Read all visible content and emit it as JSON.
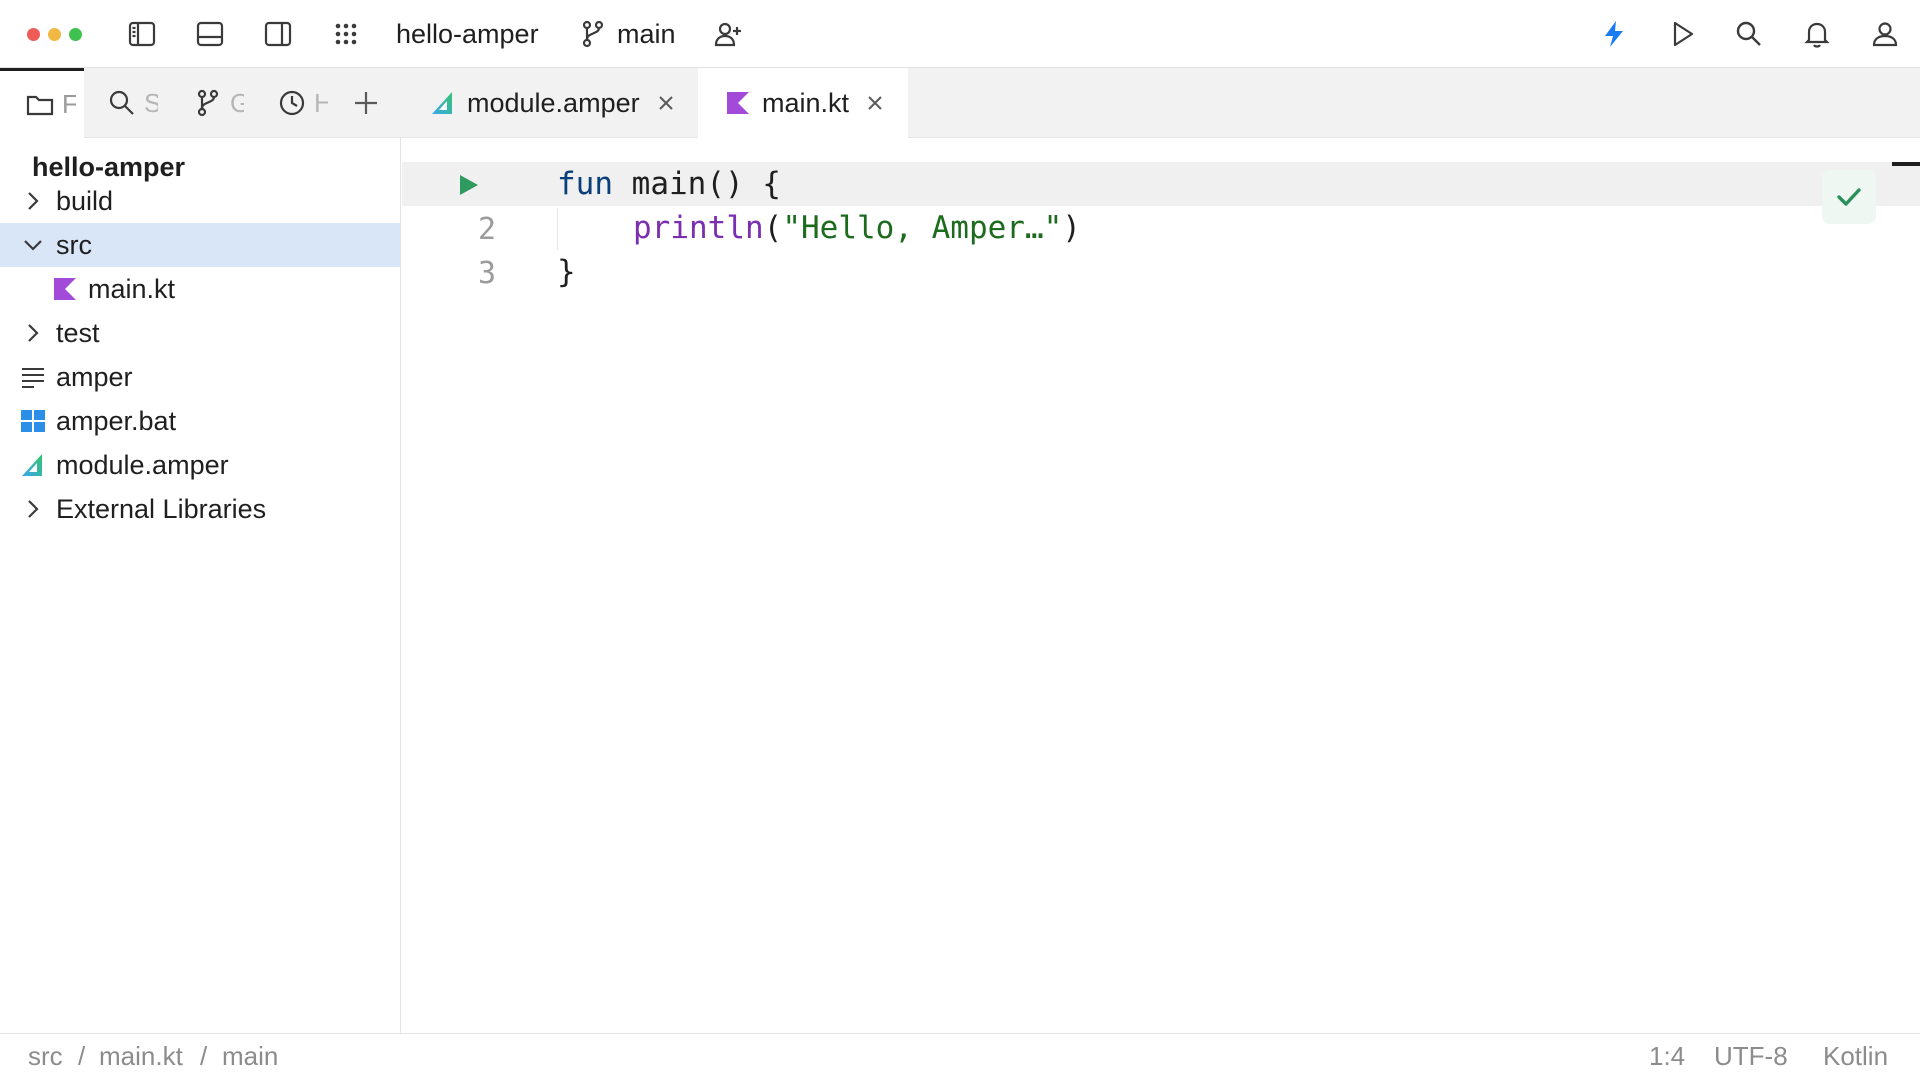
{
  "window": {
    "traffic_lights": {
      "close_color": "#ee5c56",
      "minimize_color": "#f1b844",
      "zoom_color": "#3fc24f"
    }
  },
  "titlebar": {
    "project_name": "hello-amper",
    "branch": "main",
    "icons": [
      "left-panel-icon",
      "bottom-panel-icon",
      "right-panel-icon",
      "apps-grid-icon",
      "branch-icon",
      "add-user-icon",
      "bolt-icon",
      "run-icon",
      "search-icon",
      "bell-icon",
      "user-icon"
    ],
    "accent_color": "#1a7cf0"
  },
  "tool_tabs": [
    {
      "label": "F",
      "icon": "folder-icon",
      "active": true
    },
    {
      "label": "S",
      "icon": "search-icon",
      "active": false
    },
    {
      "label": "G",
      "icon": "git-icon",
      "active": false
    },
    {
      "label": "H",
      "icon": "clock-icon",
      "active": false
    }
  ],
  "project": {
    "title": "hello-amper",
    "items": [
      {
        "name": "build",
        "icon": "chevron-right-icon",
        "level": 0,
        "selected": false
      },
      {
        "name": "src",
        "icon": "chevron-down-icon",
        "level": 0,
        "selected": true
      },
      {
        "name": "main.kt",
        "icon": "kotlin-file-icon",
        "level": 1,
        "selected": false
      },
      {
        "name": "test",
        "icon": "chevron-right-icon",
        "level": 0,
        "selected": false
      },
      {
        "name": "amper",
        "icon": "text-file-icon",
        "level": 0,
        "selected": false
      },
      {
        "name": "amper.bat",
        "icon": "windows-icon",
        "level": 0,
        "selected": false
      },
      {
        "name": "module.amper",
        "icon": "amper-icon",
        "level": 0,
        "selected": false
      },
      {
        "name": "External Libraries",
        "icon": "chevron-right-icon",
        "level": 0,
        "selected": false
      }
    ]
  },
  "editor_tabs": [
    {
      "label": "module.amper",
      "icon": "amper-icon",
      "active": false
    },
    {
      "label": "main.kt",
      "icon": "kotlin-file-icon",
      "active": true
    }
  ],
  "editor": {
    "line_numbers": [
      "2",
      "3"
    ],
    "code": {
      "line1_kw": "fun",
      "line1_rest": " main() {",
      "line2_call": "println",
      "line2_open": "(",
      "line2_str": "\"Hello, Amper…\"",
      "line2_close": ")",
      "line3": "}"
    }
  },
  "statusbar": {
    "breadcrumb": [
      "src",
      "main.kt",
      "main"
    ],
    "separator": "/",
    "position": "1:4",
    "encoding": "UTF-8",
    "language": "Kotlin"
  }
}
